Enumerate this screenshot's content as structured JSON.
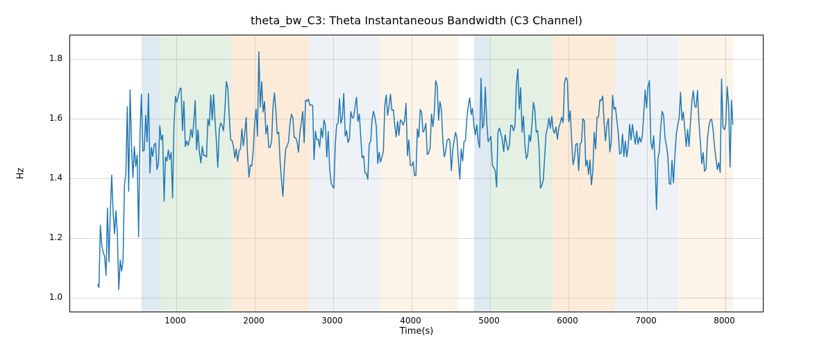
{
  "chart_data": {
    "type": "line",
    "title": "theta_bw_C3: Theta Instantaneous Bandwidth (C3 Channel)",
    "xlabel": "Time(s)",
    "ylabel": "Hz",
    "xlim": [
      -350,
      8500
    ],
    "ylim": [
      0.95,
      1.88
    ],
    "xticks": [
      1000,
      2000,
      3000,
      4000,
      5000,
      6000,
      7000,
      8000
    ],
    "yticks": [
      1.0,
      1.2,
      1.4,
      1.6,
      1.8
    ],
    "bands": [
      {
        "x0": 560,
        "x1": 800,
        "color": "#7FA9C8"
      },
      {
        "x0": 800,
        "x1": 1700,
        "color": "#8FC38F"
      },
      {
        "x0": 1700,
        "x1": 2700,
        "color": "#F5B069"
      },
      {
        "x0": 2700,
        "x1": 3600,
        "color": "#BCCCE0"
      },
      {
        "x0": 3600,
        "x1": 4600,
        "color": "#F7D3A9"
      },
      {
        "x0": 4800,
        "x1": 5000,
        "color": "#7FA9C8"
      },
      {
        "x0": 5000,
        "x1": 5800,
        "color": "#8FC38F"
      },
      {
        "x0": 5800,
        "x1": 6600,
        "color": "#F5B069"
      },
      {
        "x0": 6600,
        "x1": 7400,
        "color": "#BCCCE0"
      },
      {
        "x0": 7400,
        "x1": 8100,
        "color": "#F7D3A9"
      }
    ],
    "series": [
      {
        "name": "theta_bw_C3",
        "color": "#1f77b4"
      }
    ],
    "y_jitter": {
      "mean": 1.55,
      "amp_main": 0.15,
      "amp_noise": 0.06,
      "startup_dip_min": 1.0,
      "startup_dip_x_end": 700,
      "n_points": 450,
      "seed": 11
    }
  }
}
